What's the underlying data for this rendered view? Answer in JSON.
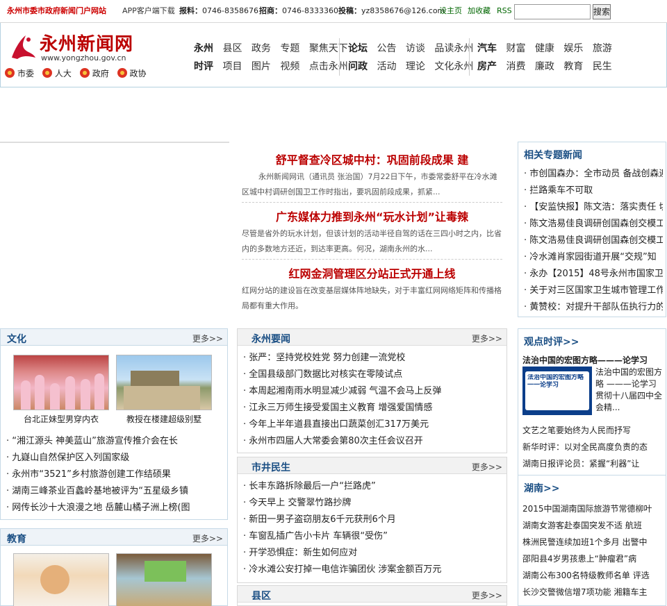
{
  "topbar": {
    "site_tag": "永州市委市政府新闻门户网站",
    "app": "APP客户端下载",
    "tel_label": "报料：",
    "tel": "0746-8358676",
    "recruit_label": "招商：",
    "recruit_tel": "0746-8333360",
    "mail_label": "投稿：",
    "mail": "yz8358676@126.com",
    "home": "设主页",
    "fav": "加收藏",
    "rss": "RSS",
    "search_value": "",
    "search_btn": "搜索"
  },
  "logo": {
    "name": "永州新闻网",
    "url": "www.yongzhou.gov.cn"
  },
  "gov_links": [
    "市委",
    "人大",
    "政府",
    "政协"
  ],
  "nav": {
    "group1": {
      "row1": [
        "永州",
        "县区",
        "政务",
        "专题",
        "聚焦天下"
      ],
      "row2": [
        "时评",
        "项目",
        "图片",
        "视频",
        "点击永州"
      ]
    },
    "group2": {
      "row1": [
        "论坛",
        "公告",
        "访谈",
        "品读永州"
      ],
      "row2": [
        "问政",
        "活动",
        "理论",
        "文化永州"
      ]
    },
    "group3": {
      "row1": [
        "汽车",
        "财富",
        "健康",
        "娱乐",
        "旅游"
      ],
      "row2": [
        "房产",
        "消费",
        "廉政",
        "教育",
        "民生"
      ]
    }
  },
  "headlines": [
    {
      "title": "舒平督查冷区城中村：巩固前段成果 建",
      "summary": "永州新闻网讯（通讯员 张治国）7月22日下午，市委常委舒平在冷水滩区城中村调研创国卫工作时指出，要巩固前段成果，抓紧..."
    },
    {
      "title": "广东媒体力推到永州“玩水计划”让毒辣",
      "summary": "尽管是省外的玩水计划，但该计划的活动半径自驾的话在三四小时之内，比省内的多数地方还近，到达率更高。何况，湖南永州的水..."
    },
    {
      "title": "红网金洞管理区分站正式开通上线",
      "summary": "红网分站的建设旨在改变基层媒体阵地缺失，对于丰富红网网络矩阵和传播格局都有重大作用。"
    }
  ],
  "related": {
    "title": "相关专题新闻",
    "items": [
      "市创国森办：全市动员 备战创森迎",
      "拦路乘车不可取",
      "【安监快报】陈文浩：落实责任 切",
      "陈文浩易佳良调研创国森创交模工",
      "陈文浩易佳良调研创国森创交模工",
      "冷水滩肖家园街道开展“交规”知",
      "永办【2015】48号永州市国家卫生",
      "关于对三区国家卫生城市管理工作8",
      "黄赞校：对提升干部队伍执行力的"
    ]
  },
  "culture": {
    "title": "文化",
    "more": "更多>>",
    "photos": [
      {
        "caption": "台北正妹型男穿内衣"
      },
      {
        "caption": "教授在楼建超级别墅"
      }
    ],
    "items": [
      "“湘江源头 神美蓝山”旅游宣传推介会在长",
      "九嶷山自然保护区入列国家级",
      "永州市“3521”乡村旅游创建工作结硕果",
      "湖南三峰茶业百蠡岭基地被评为“五星级乡镇",
      "网传长沙十大浪漫之地 岳麓山橘子洲上榜(图"
    ]
  },
  "yznews": {
    "title": "永州要闻",
    "more": "更多>>",
    "items": [
      "张严：坚持党校姓党  努力创建一流党校",
      "全国县级部门数据比对核实在零陵试点",
      "本周起湘南雨水明显减少减弱 气温不会马上反弹",
      "江永三万师生接受爱国主义教育 增强爱国情感",
      "今年上半年道县直接出口蔬菜创汇317万美元",
      "永州市四届人大常委会第80次主任会议召开"
    ]
  },
  "market": {
    "title": "市井民生",
    "more": "更多>>",
    "items": [
      "长丰东路拆除最后一户“拦路虎”",
      "今天早上 交警翠竹路抄牌",
      "新田一男子盗窃朋友6千元获刑6个月",
      "车窗乱插广告小卡片 车辆很“受伤”",
      "开学恐惧症：新生如何应对",
      "冷水滩公安打掉一电信诈骗团伙 涉案金额百万元"
    ]
  },
  "county": {
    "title": "县区",
    "more": "更多>>"
  },
  "education": {
    "title": "教育",
    "more": "更多>>"
  },
  "opinion": {
    "title": "观点时评>>",
    "feature_title": "法治中国的宏图方略———论学习",
    "feature_text": [
      "法治中国的宏图方",
      "略 ———论学习",
      "贯彻十八届四中全",
      "会精..."
    ],
    "banner": "法治中国的宏图方略一一论学习",
    "items": [
      "文艺之笔要始终为人民而抒写",
      "新华时评：以对全民高度负责的态",
      "湖南日报评论员：紧握“利器”让"
    ]
  },
  "hunan": {
    "title": "湖南>>",
    "items": [
      "2015中国湖南国际旅游节常德柳叶",
      "湖南女游客赴泰国突发不适 航班",
      "株洲民警连续加班1个多月 出警中",
      "邵阳县4岁男孩患上“肿瘤君”病",
      "湖南公布300名特级教师名单 评选",
      "长沙交警微信增7项功能 湘籍车主"
    ]
  }
}
